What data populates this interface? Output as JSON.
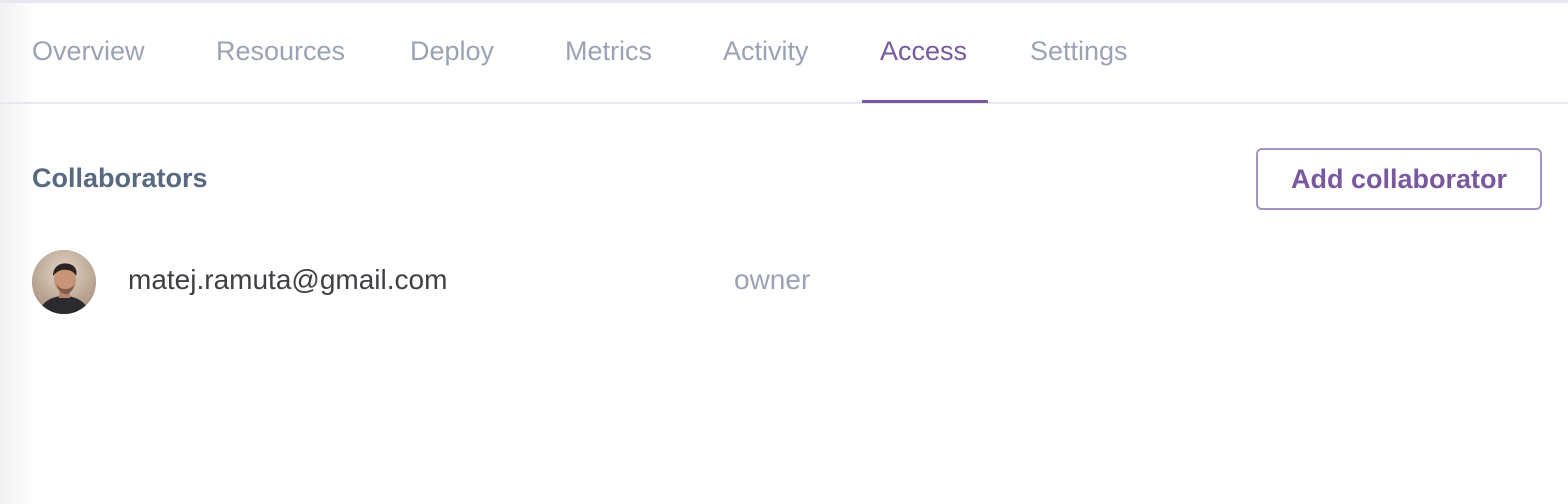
{
  "tabs": [
    {
      "label": "Overview",
      "active": false
    },
    {
      "label": "Resources",
      "active": false
    },
    {
      "label": "Deploy",
      "active": false
    },
    {
      "label": "Metrics",
      "active": false
    },
    {
      "label": "Activity",
      "active": false
    },
    {
      "label": "Access",
      "active": true
    },
    {
      "label": "Settings",
      "active": false
    }
  ],
  "collaborators": {
    "title": "Collaborators",
    "add_button_label": "Add collaborator",
    "items": [
      {
        "email": "matej.ramuta@gmail.com",
        "role": "owner",
        "avatar": "user-avatar-photo"
      }
    ]
  },
  "colors": {
    "accent": "#79589f",
    "tab_inactive": "#9aa3b5",
    "heading": "#596981",
    "button_border": "#a593c2"
  }
}
